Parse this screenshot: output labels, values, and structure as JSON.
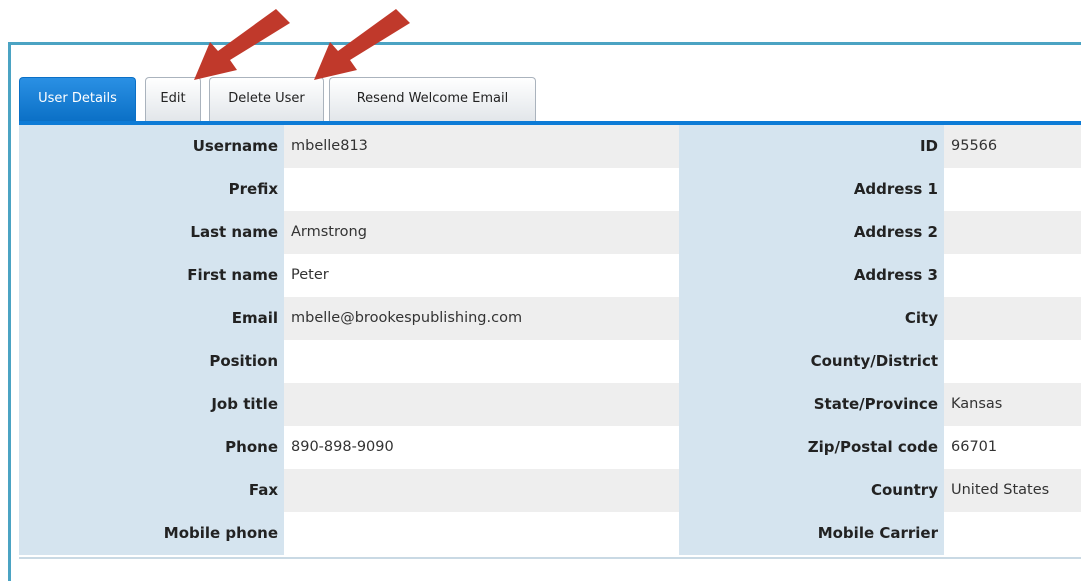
{
  "tabs": [
    {
      "label": "User Details",
      "active": true
    },
    {
      "label": "Edit",
      "active": false
    },
    {
      "label": "Delete User",
      "active": false
    },
    {
      "label": "Resend Welcome Email",
      "active": false
    }
  ],
  "left_fields": [
    {
      "label": "Username",
      "value": "mbelle813"
    },
    {
      "label": "Prefix",
      "value": ""
    },
    {
      "label": "Last name",
      "value": "Armstrong"
    },
    {
      "label": "First name",
      "value": "Peter"
    },
    {
      "label": "Email",
      "value": "mbelle@brookespublishing.com"
    },
    {
      "label": "Position",
      "value": ""
    },
    {
      "label": "Job title",
      "value": ""
    },
    {
      "label": "Phone",
      "value": "890-898-9090"
    },
    {
      "label": "Fax",
      "value": ""
    },
    {
      "label": "Mobile phone",
      "value": ""
    }
  ],
  "right_fields": [
    {
      "label": "ID",
      "value": "95566"
    },
    {
      "label": "Address 1",
      "value": ""
    },
    {
      "label": "Address 2",
      "value": ""
    },
    {
      "label": "Address 3",
      "value": ""
    },
    {
      "label": "City",
      "value": ""
    },
    {
      "label": "County/District",
      "value": ""
    },
    {
      "label": "State/Province",
      "value": "Kansas"
    },
    {
      "label": "Zip/Postal code",
      "value": "66701"
    },
    {
      "label": "Country",
      "value": "United States"
    },
    {
      "label": "Mobile Carrier",
      "value": ""
    }
  ],
  "colors": {
    "frame": "#4ba3c3",
    "active_tab": "#0b70c6",
    "label_bg": "#d5e4ef",
    "row_alt": "#eeeeee",
    "arrow": "#c0392b"
  },
  "annotations": [
    {
      "name": "arrow-to-edit",
      "points_to": "Edit"
    },
    {
      "name": "arrow-to-delete-user",
      "points_to": "Delete User"
    }
  ]
}
